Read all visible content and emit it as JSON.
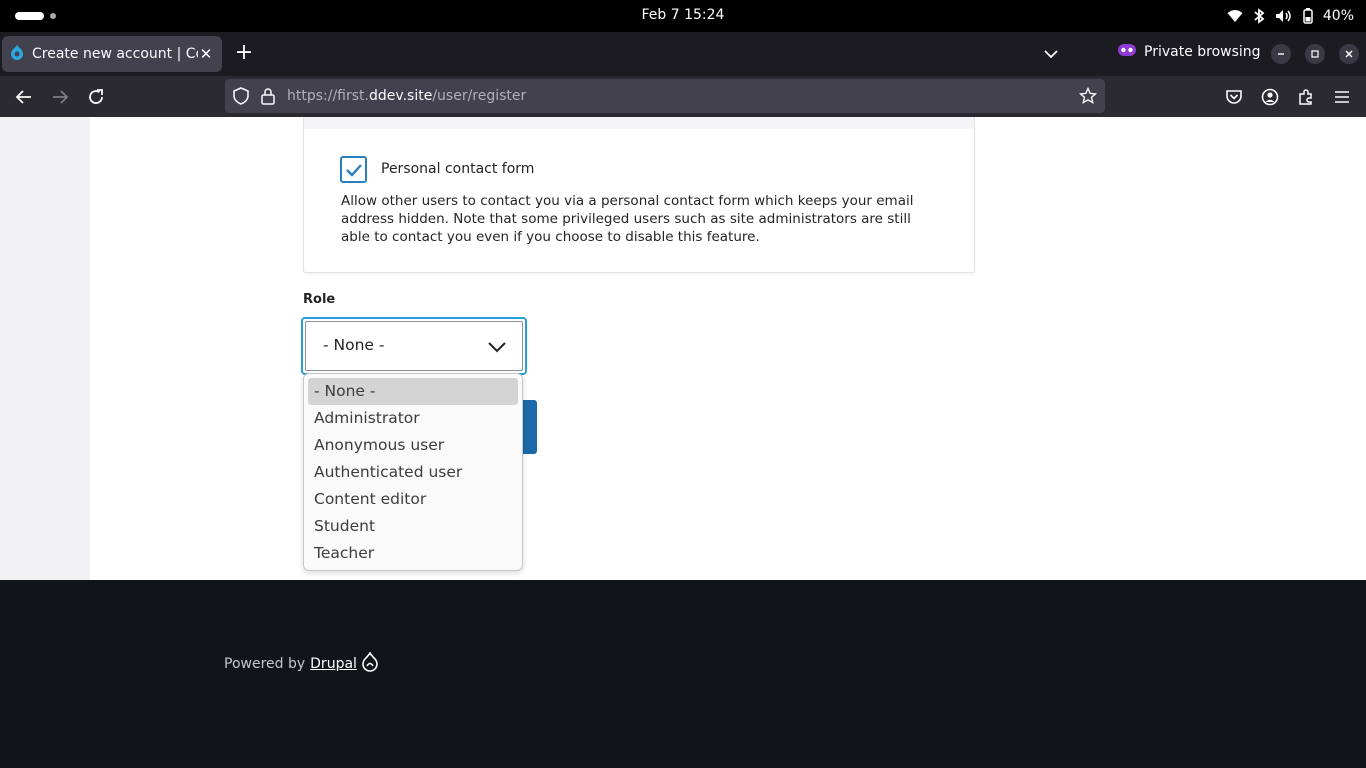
{
  "system": {
    "datetime": "Feb 7  15:24",
    "battery": "40%"
  },
  "tab": {
    "title": "Create new account | Coll",
    "icon": "drupal-icon"
  },
  "browser": {
    "private_label": "Private browsing",
    "url_prefix": "https://first.",
    "url_host": "ddev.site",
    "url_path": "/user/register"
  },
  "form": {
    "contact_checkbox_checked": true,
    "contact_label": "Personal contact form",
    "contact_help": "Allow other users to contact you via a personal contact form which keeps your email address hidden. Note that some privileged users such as site administrators are still able to contact you even if you choose to disable this feature.",
    "role_label": "Role",
    "role_value": "- None -",
    "role_options": [
      "- None -",
      "Administrator",
      "Anonymous user",
      "Authenticated user",
      "Content editor",
      "Student",
      "Teacher"
    ]
  },
  "footer": {
    "powered_by": "Powered by",
    "drupal_link": "Drupal"
  },
  "colors": {
    "focus": "#26a0da",
    "checkbox": "#2a7fbf",
    "button": "#1b69a8"
  }
}
